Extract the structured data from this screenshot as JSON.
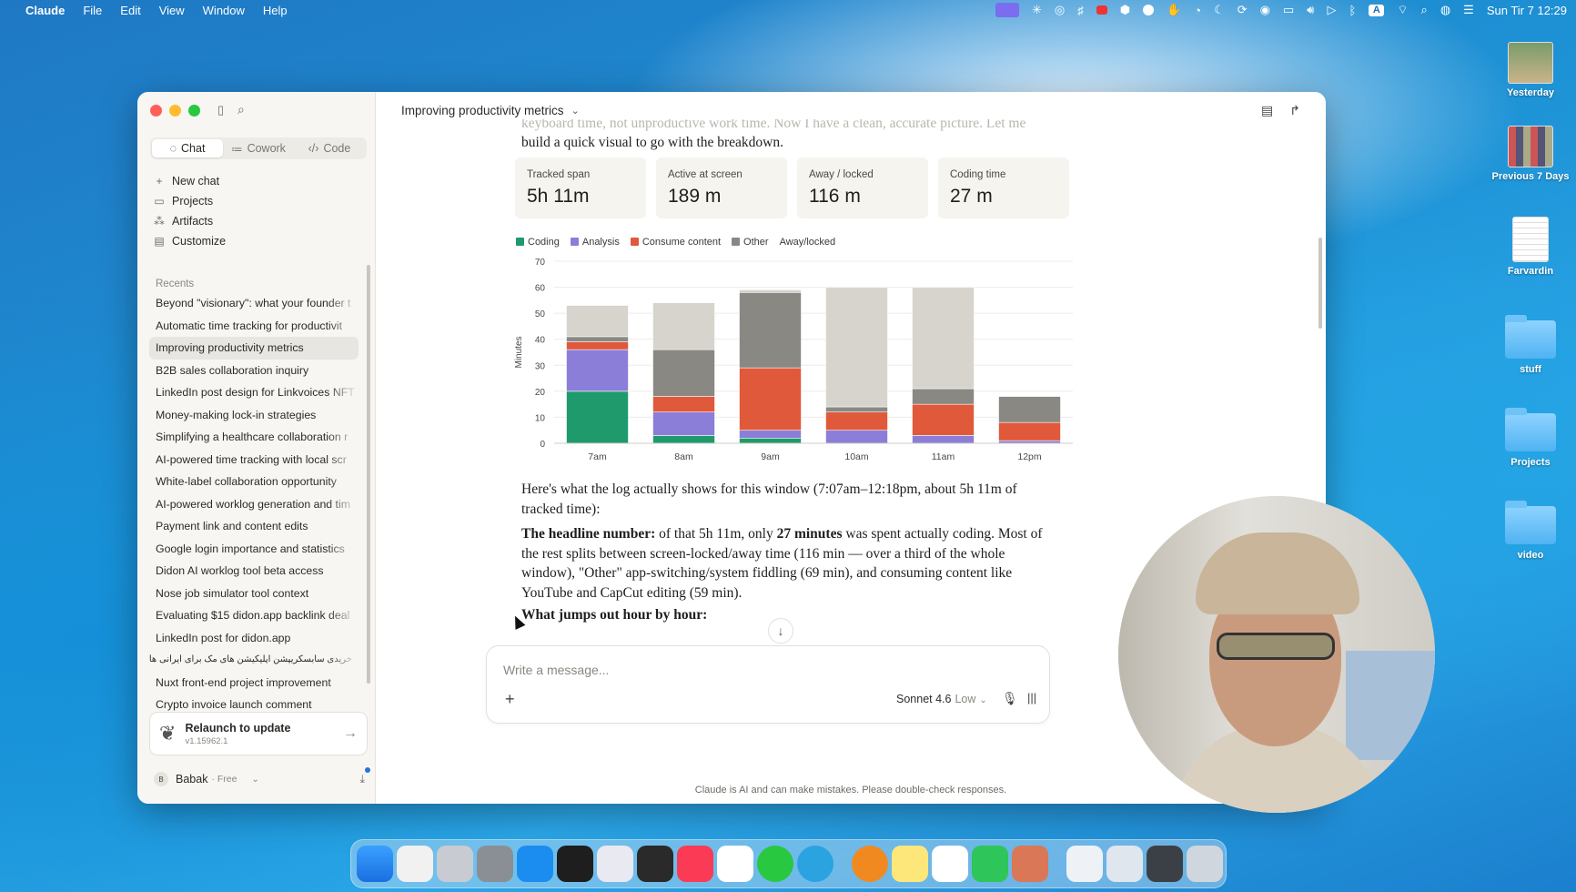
{
  "menubar": {
    "app": "Claude",
    "items": [
      "File",
      "Edit",
      "View",
      "Window",
      "Help"
    ],
    "clock": "Sun Tir 7  12:29"
  },
  "desktop": {
    "icons": [
      {
        "label": "Yesterday",
        "kind": "thumb"
      },
      {
        "label": "Previous 7 Days",
        "kind": "thumb"
      },
      {
        "label": "Farvardin",
        "kind": "doc"
      },
      {
        "label": "stuff",
        "kind": "folder"
      },
      {
        "label": "Projects",
        "kind": "folder"
      },
      {
        "label": "video",
        "kind": "folder"
      }
    ]
  },
  "sidebar": {
    "tabs": [
      {
        "label": "Chat",
        "icon": "chat-bubble-icon"
      },
      {
        "label": "Cowork",
        "icon": "cowork-icon"
      },
      {
        "label": "Code",
        "icon": "code-icon"
      }
    ],
    "nav": [
      {
        "label": "New chat",
        "icon": "plus-icon"
      },
      {
        "label": "Projects",
        "icon": "folder-icon"
      },
      {
        "label": "Artifacts",
        "icon": "artifacts-icon"
      },
      {
        "label": "Customize",
        "icon": "briefcase-icon"
      }
    ],
    "recents_header": "Recents",
    "recents": [
      "Beyond \"visionary\": what your founder t",
      "Automatic time tracking for productivit",
      "Improving productivity metrics",
      "B2B sales collaboration inquiry",
      "LinkedIn post design for Linkvoices NFT",
      "Money-making lock-in strategies",
      "Simplifying a healthcare collaboration r",
      "AI-powered time tracking with local scr",
      "White-label collaboration opportunity",
      "AI-powered worklog generation and tim",
      "Payment link and content edits",
      "Google login importance and statistics",
      "Didon AI worklog tool beta access",
      "Nose job simulator tool context",
      "Evaluating $15 didon.app backlink deal",
      "LinkedIn post for didon.app",
      "خریدی سابسکریپشن اپلیکیشن های مک برای ایرانی ها",
      "Nuxt front-end project improvement",
      "Crypto invoice launch comment"
    ],
    "active_recent": 2,
    "update": {
      "title": "Relaunch to update",
      "version": "v1.15962.1"
    },
    "user": {
      "initial": "B",
      "name": "Babak",
      "plan": "· Free"
    }
  },
  "conversation": {
    "title": "Improving productivity metrics",
    "faded_line": "keyboard time, not unproductive work time. Now I have a clean, accurate picture. Let me",
    "intro_line": "build a quick visual to go with the breakdown.",
    "stats": [
      {
        "label": "Tracked span",
        "value": "5h 11m"
      },
      {
        "label": "Active at screen",
        "value": "189 m"
      },
      {
        "label": "Away / locked",
        "value": "116 m"
      },
      {
        "label": "Coding time",
        "value": "27 m"
      }
    ],
    "para1": "Here's what the log actually shows for this window (7:07am–12:18pm, about 5h 11m of tracked time):",
    "para2_bold1": "The headline number:",
    "para2_a": " of that 5h 11m, only ",
    "para2_bold2": "27 minutes",
    "para2_b": " was spent actually coding. Most of the rest splits between screen-locked/away time (116 min — over a third of the whole window), \"Other\" app-switching/system fiddling (69 min), and consuming content like YouTube and CapCut editing (59 min).",
    "heading": "What jumps out hour by hour:"
  },
  "composer": {
    "placeholder": "Write a message...",
    "model": "Sonnet 4.6",
    "effort": "Low"
  },
  "disclaimer": "Claude is AI and can make mistakes. Please double-check responses.",
  "colors": {
    "coding": "#1f9a6d",
    "analysis": "#8b7ed8",
    "consume": "#e0593a",
    "other": "#8a8883",
    "away": "#d6d4cd",
    "accent": "#d97757"
  },
  "chart_data": {
    "type": "bar",
    "stacked": true,
    "categories": [
      "7am",
      "8am",
      "9am",
      "10am",
      "11am",
      "12pm"
    ],
    "series": [
      {
        "name": "Coding",
        "values": [
          20,
          3,
          2,
          0,
          0,
          0
        ]
      },
      {
        "name": "Analysis",
        "values": [
          16,
          9,
          3,
          5,
          3,
          1
        ]
      },
      {
        "name": "Consume content",
        "values": [
          3,
          6,
          24,
          7,
          12,
          7
        ]
      },
      {
        "name": "Other",
        "values": [
          2,
          18,
          29,
          2,
          6,
          10
        ]
      },
      {
        "name": "Away/locked",
        "values": [
          12,
          18,
          1,
          46,
          39,
          0
        ]
      }
    ],
    "ylabel": "Minutes",
    "yticks": [
      0,
      10,
      20,
      30,
      40,
      50,
      60,
      70
    ],
    "ylim": [
      0,
      70
    ],
    "legend_position": "top-left",
    "grid": true
  }
}
